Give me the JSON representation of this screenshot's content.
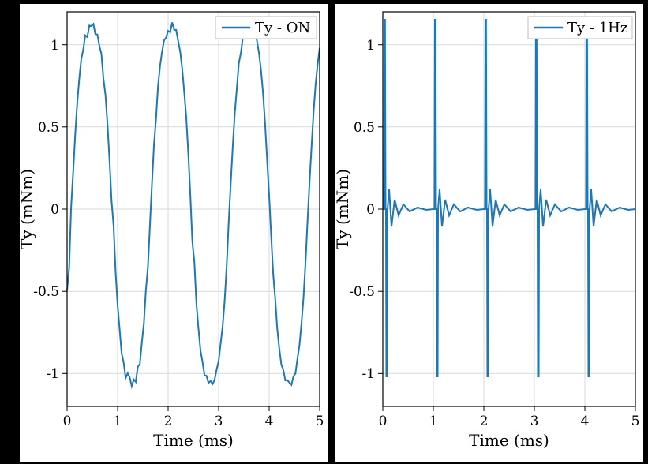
{
  "chart_data": [
    {
      "type": "line",
      "series": [
        {
          "name": "Ty - ON"
        }
      ],
      "xlabel": "Time (ms)",
      "ylabel": "Ty (mNm)",
      "xticks": [
        0,
        1,
        2,
        3,
        4,
        5
      ],
      "yticks": [
        -1,
        -0.5,
        0,
        0.5,
        1
      ],
      "xlim": [
        0,
        5
      ],
      "ylim": [
        -1.2,
        1.2
      ],
      "legend_position": "top-right",
      "description": "Smooth quasi-sinusoidal torque waveform, ~1 Hz, amplitude ~1 mNm, slight negative DC offset and mild asymmetry/ripple."
    },
    {
      "type": "line",
      "series": [
        {
          "name": "Ty - 1Hz"
        }
      ],
      "xlabel": "Time (ms)",
      "ylabel": "Ty (mNm)",
      "xticks": [
        0,
        1,
        2,
        3,
        4,
        5
      ],
      "yticks": [
        -1,
        -0.5,
        0,
        0.5,
        1
      ],
      "xlim": [
        0,
        5
      ],
      "ylim": [
        -1.2,
        1.2
      ],
      "legend_position": "top-right",
      "description": "Impulsive torque: baseline near 0 with small ringing; narrow positive spikes to ~+1.15 and negative spikes to ~-1.0 near t≈0.05,1.05,2.05,3.05,4.05 s."
    }
  ],
  "left": {
    "legend": "Ty - ON",
    "xlabel": "Time (ms)",
    "ylabel": "Ty (mNm)",
    "xticks": [
      "0",
      "1",
      "2",
      "3",
      "4",
      "5"
    ],
    "yticks": [
      "-1",
      "-0.5",
      "0",
      "0.5",
      "1"
    ]
  },
  "right": {
    "legend": "Ty - 1Hz",
    "xlabel": "Time (ms)",
    "ylabel": "Ty (mNm)",
    "xticks": [
      "0",
      "1",
      "2",
      "3",
      "4",
      "5"
    ],
    "yticks": [
      "-1",
      "-0.5",
      "0",
      "0.5",
      "1"
    ]
  }
}
